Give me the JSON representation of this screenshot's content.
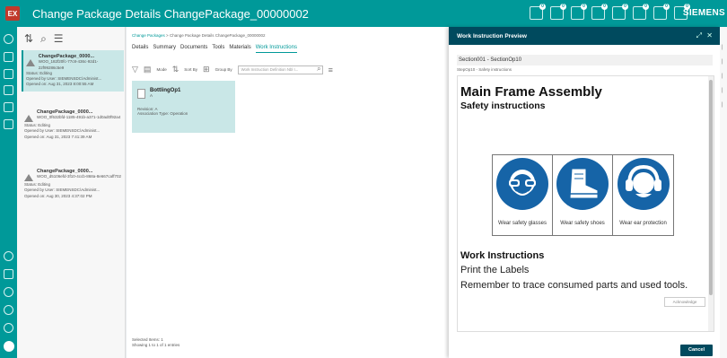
{
  "app": {
    "logo": "EX",
    "title": "Change Package Details ChangePackage_00000002",
    "brand": "SIEMENS"
  },
  "topbar": {
    "badges": [
      "0",
      "0",
      "0",
      "0",
      "0",
      "0",
      "0",
      "0"
    ]
  },
  "list": {
    "cards": [
      {
        "title": "ChangePackage_0000...",
        "id": "WOO_182f20fc-77c8-436c-92d1-22f99286c5e9",
        "status": "Status: Editing",
        "opened_by": "Opened by User: SIEMENSDC\\Administ...",
        "opened_on": "Opened on: Aug 31, 2023 8:00:55 AM"
      },
      {
        "title": "ChangePackage_0000...",
        "id": "WOO_0f632bfd-1185-491b-a371-1d0ad0f92a4",
        "status": "Status: Editing",
        "opened_by": "Opened by User: SIEMENSDC\\Administ...",
        "opened_on": "Opened on: Aug 31, 2023 7:41:39 AM"
      },
      {
        "title": "ChangePackage_0000...",
        "id": "WOO_d5106efd-3f10-4ccb-868a-8e667caff702",
        "status": "Status: Editing",
        "opened_by": "Opened by User: SIEMENSDC\\Administ...",
        "opened_on": "Opened on: Aug 30, 2023 4:37:02 PM"
      }
    ]
  },
  "main": {
    "breadcrumb": {
      "root": "Change Packages",
      "sep": ">",
      "current": "Change Package Details ChangePackage_00000002"
    },
    "tabs": [
      "Details",
      "Summary",
      "Documents",
      "Tools",
      "Materials",
      "Work Instructions"
    ],
    "toolbar": {
      "mode": "Mode",
      "sort": "Sort By",
      "group": "Group By",
      "search_placeholder": "Work Instruction Definition Nbl I..."
    },
    "card": {
      "title": "BottlingOp1",
      "sub": "A",
      "revision": "Revision: A",
      "assoc": "Association Type: Operation"
    },
    "footer": {
      "selected": "Selected Items: 1",
      "showing": "Showing 1 to 1 of 1 entries"
    }
  },
  "preview": {
    "title": "Work Instruction Preview",
    "section": "Section001 - SectionOp10",
    "step": "StepOp10 - Safety instructions",
    "heading": "Main Frame Assembly",
    "subheading": "Safety instructions",
    "captions": [
      "Wear safety glasses",
      "Wear safety shoes",
      "Wear ear protection"
    ],
    "wi_heading": "Work Instructions",
    "line1": "Print the Labels",
    "line2": "Remember to trace consumed parts and used tools.",
    "acknowledge": "Acknowledge",
    "cancel": "Cancel"
  }
}
